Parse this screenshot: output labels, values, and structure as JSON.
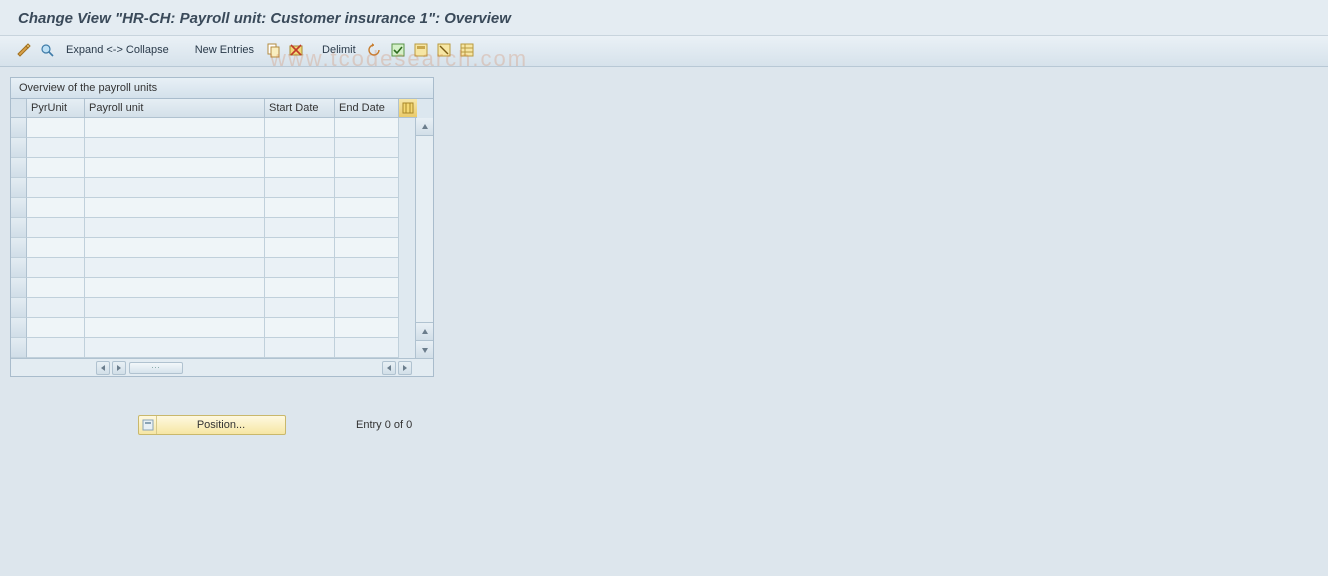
{
  "title": "Change View \"HR-CH: Payroll unit: Customer insurance 1\": Overview",
  "toolbar": {
    "expand_collapse": "Expand <-> Collapse",
    "new_entries": "New Entries",
    "delimit": "Delimit"
  },
  "grid": {
    "title": "Overview of the payroll units",
    "columns": {
      "pyrunit": "PyrUnit",
      "payroll_unit": "Payroll unit",
      "start_date": "Start Date",
      "end_date": "End Date"
    },
    "rows": [
      {
        "pyrunit": "",
        "payroll_unit": "",
        "start_date": "",
        "end_date": ""
      },
      {
        "pyrunit": "",
        "payroll_unit": "",
        "start_date": "",
        "end_date": ""
      },
      {
        "pyrunit": "",
        "payroll_unit": "",
        "start_date": "",
        "end_date": ""
      },
      {
        "pyrunit": "",
        "payroll_unit": "",
        "start_date": "",
        "end_date": ""
      },
      {
        "pyrunit": "",
        "payroll_unit": "",
        "start_date": "",
        "end_date": ""
      },
      {
        "pyrunit": "",
        "payroll_unit": "",
        "start_date": "",
        "end_date": ""
      },
      {
        "pyrunit": "",
        "payroll_unit": "",
        "start_date": "",
        "end_date": ""
      },
      {
        "pyrunit": "",
        "payroll_unit": "",
        "start_date": "",
        "end_date": ""
      },
      {
        "pyrunit": "",
        "payroll_unit": "",
        "start_date": "",
        "end_date": ""
      },
      {
        "pyrunit": "",
        "payroll_unit": "",
        "start_date": "",
        "end_date": ""
      },
      {
        "pyrunit": "",
        "payroll_unit": "",
        "start_date": "",
        "end_date": ""
      },
      {
        "pyrunit": "",
        "payroll_unit": "",
        "start_date": "",
        "end_date": ""
      }
    ]
  },
  "footer": {
    "position": "Position...",
    "entry": "Entry 0 of 0"
  },
  "watermark": "www.tcodesearch.com"
}
